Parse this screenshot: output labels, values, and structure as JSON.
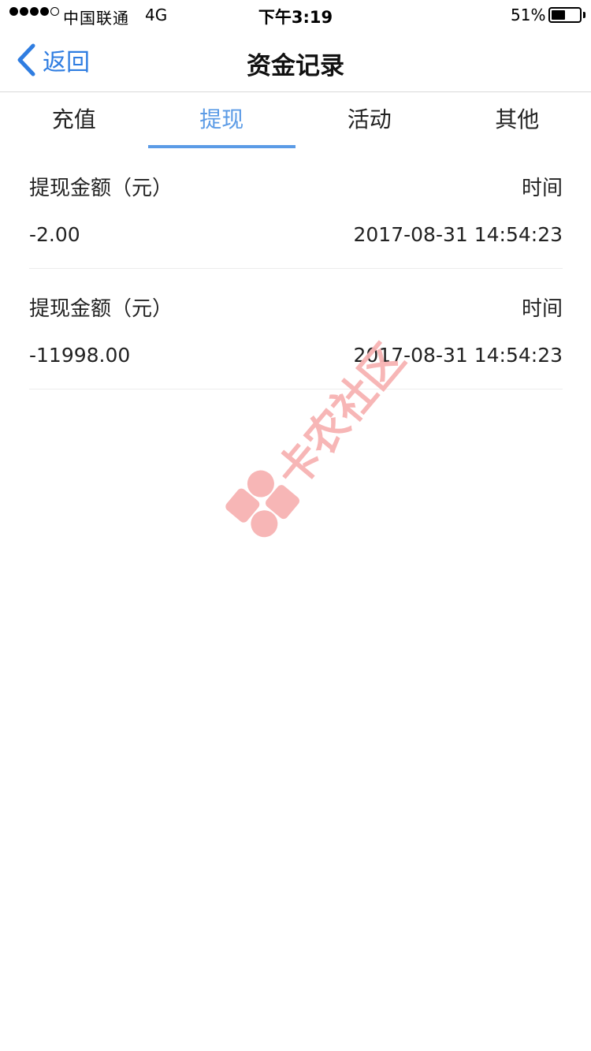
{
  "status_bar": {
    "carrier": "中国联通",
    "network": "4G",
    "time": "下午3:19",
    "battery_percent": "51%",
    "battery_level": 0.51
  },
  "nav": {
    "back_label": "返回",
    "title": "资金记录"
  },
  "tabs": [
    {
      "label": "充值",
      "active": false
    },
    {
      "label": "提现",
      "active": true
    },
    {
      "label": "活动",
      "active": false
    },
    {
      "label": "其他",
      "active": false
    }
  ],
  "records": [
    {
      "amount_label": "提现金额（元）",
      "time_label": "时间",
      "amount": "-2.00",
      "time": "2017-08-31 14:54:23"
    },
    {
      "amount_label": "提现金额（元）",
      "time_label": "时间",
      "amount": "-11998.00",
      "time": "2017-08-31 14:54:23"
    }
  ],
  "watermark": {
    "text": "卡农社区",
    "icon": "kanong-logo-icon"
  },
  "colors": {
    "accent": "#5b9be6",
    "back": "#2f7de1",
    "watermark": "#f7b3b3"
  }
}
